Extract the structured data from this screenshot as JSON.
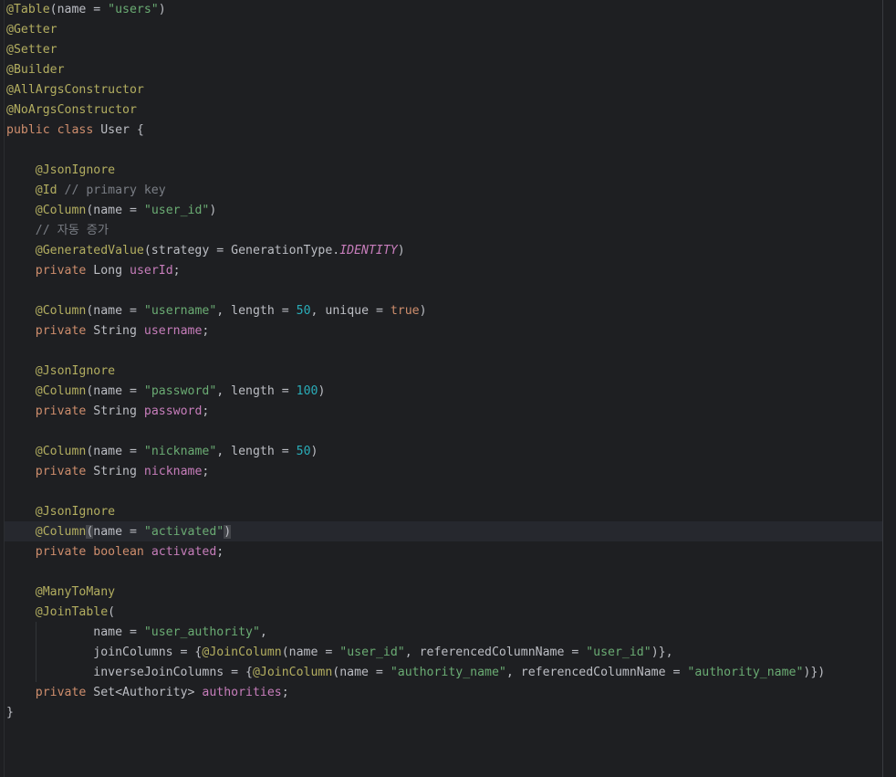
{
  "lines": [
    {
      "indent": 0,
      "tokens": [
        {
          "t": "@Table",
          "c": "ann"
        },
        {
          "t": "(name = ",
          "c": "plain"
        },
        {
          "t": "\"users\"",
          "c": "str"
        },
        {
          "t": ")",
          "c": "plain"
        }
      ]
    },
    {
      "indent": 0,
      "tokens": [
        {
          "t": "@Getter",
          "c": "ann"
        }
      ]
    },
    {
      "indent": 0,
      "tokens": [
        {
          "t": "@Setter",
          "c": "ann"
        }
      ]
    },
    {
      "indent": 0,
      "tokens": [
        {
          "t": "@Builder",
          "c": "ann"
        }
      ]
    },
    {
      "indent": 0,
      "tokens": [
        {
          "t": "@AllArgsConstructor",
          "c": "ann"
        }
      ]
    },
    {
      "indent": 0,
      "tokens": [
        {
          "t": "@NoArgsConstructor",
          "c": "ann"
        }
      ]
    },
    {
      "indent": 0,
      "tokens": [
        {
          "t": "public ",
          "c": "kw"
        },
        {
          "t": "class ",
          "c": "kw"
        },
        {
          "t": "User {",
          "c": "plain"
        }
      ]
    },
    {
      "indent": 0,
      "tokens": []
    },
    {
      "indent": 1,
      "tokens": [
        {
          "t": "@JsonIgnore",
          "c": "ann"
        }
      ]
    },
    {
      "indent": 1,
      "tokens": [
        {
          "t": "@Id",
          "c": "ann"
        },
        {
          "t": " // primary key",
          "c": "cmt"
        }
      ]
    },
    {
      "indent": 1,
      "tokens": [
        {
          "t": "@Column",
          "c": "ann"
        },
        {
          "t": "(name = ",
          "c": "plain"
        },
        {
          "t": "\"user_id\"",
          "c": "str"
        },
        {
          "t": ")",
          "c": "plain"
        }
      ]
    },
    {
      "indent": 1,
      "tokens": [
        {
          "t": "// 자동 증가",
          "c": "cmt"
        }
      ]
    },
    {
      "indent": 1,
      "tokens": [
        {
          "t": "@GeneratedValue",
          "c": "ann"
        },
        {
          "t": "(strategy = GenerationType.",
          "c": "plain"
        },
        {
          "t": "IDENTITY",
          "c": "static"
        },
        {
          "t": ")",
          "c": "plain"
        }
      ]
    },
    {
      "indent": 1,
      "tokens": [
        {
          "t": "private ",
          "c": "kw"
        },
        {
          "t": "Long ",
          "c": "plain"
        },
        {
          "t": "userId",
          "c": "field"
        },
        {
          "t": ";",
          "c": "plain"
        }
      ]
    },
    {
      "indent": 0,
      "tokens": []
    },
    {
      "indent": 1,
      "tokens": [
        {
          "t": "@Column",
          "c": "ann"
        },
        {
          "t": "(name = ",
          "c": "plain"
        },
        {
          "t": "\"username\"",
          "c": "str"
        },
        {
          "t": ", length = ",
          "c": "plain"
        },
        {
          "t": "50",
          "c": "num"
        },
        {
          "t": ", unique = ",
          "c": "plain"
        },
        {
          "t": "true",
          "c": "kw"
        },
        {
          "t": ")",
          "c": "plain"
        }
      ]
    },
    {
      "indent": 1,
      "tokens": [
        {
          "t": "private ",
          "c": "kw"
        },
        {
          "t": "String ",
          "c": "plain"
        },
        {
          "t": "username",
          "c": "field"
        },
        {
          "t": ";",
          "c": "plain"
        }
      ]
    },
    {
      "indent": 0,
      "tokens": []
    },
    {
      "indent": 1,
      "tokens": [
        {
          "t": "@JsonIgnore",
          "c": "ann"
        }
      ]
    },
    {
      "indent": 1,
      "tokens": [
        {
          "t": "@Column",
          "c": "ann"
        },
        {
          "t": "(name = ",
          "c": "plain"
        },
        {
          "t": "\"password\"",
          "c": "str"
        },
        {
          "t": ", length = ",
          "c": "plain"
        },
        {
          "t": "100",
          "c": "num"
        },
        {
          "t": ")",
          "c": "plain"
        }
      ]
    },
    {
      "indent": 1,
      "tokens": [
        {
          "t": "private ",
          "c": "kw"
        },
        {
          "t": "String ",
          "c": "plain"
        },
        {
          "t": "password",
          "c": "field"
        },
        {
          "t": ";",
          "c": "plain"
        }
      ]
    },
    {
      "indent": 0,
      "tokens": []
    },
    {
      "indent": 1,
      "tokens": [
        {
          "t": "@Column",
          "c": "ann"
        },
        {
          "t": "(name = ",
          "c": "plain"
        },
        {
          "t": "\"nickname\"",
          "c": "str"
        },
        {
          "t": ", length = ",
          "c": "plain"
        },
        {
          "t": "50",
          "c": "num"
        },
        {
          "t": ")",
          "c": "plain"
        }
      ]
    },
    {
      "indent": 1,
      "tokens": [
        {
          "t": "private ",
          "c": "kw"
        },
        {
          "t": "String ",
          "c": "plain"
        },
        {
          "t": "nickname",
          "c": "field"
        },
        {
          "t": ";",
          "c": "plain"
        }
      ]
    },
    {
      "indent": 0,
      "tokens": []
    },
    {
      "indent": 1,
      "tokens": [
        {
          "t": "@JsonIgnore",
          "c": "ann"
        }
      ]
    },
    {
      "indent": 1,
      "tokens": [
        {
          "t": "@Column",
          "c": "ann"
        },
        {
          "t": "(",
          "c": "plain brace-hl"
        },
        {
          "t": "name = ",
          "c": "plain"
        },
        {
          "t": "\"activated\"",
          "c": "str"
        },
        {
          "t": ")",
          "c": "plain brace-hl"
        }
      ]
    },
    {
      "indent": 1,
      "tokens": [
        {
          "t": "private ",
          "c": "kw"
        },
        {
          "t": "boolean ",
          "c": "kw"
        },
        {
          "t": "activated",
          "c": "field"
        },
        {
          "t": ";",
          "c": "plain"
        }
      ]
    },
    {
      "indent": 0,
      "tokens": []
    },
    {
      "indent": 1,
      "tokens": [
        {
          "t": "@ManyToMany",
          "c": "ann"
        }
      ]
    },
    {
      "indent": 1,
      "tokens": [
        {
          "t": "@JoinTable",
          "c": "ann"
        },
        {
          "t": "(",
          "c": "plain"
        }
      ]
    },
    {
      "indent": 3,
      "tokens": [
        {
          "t": "name = ",
          "c": "plain"
        },
        {
          "t": "\"user_authority\"",
          "c": "str"
        },
        {
          "t": ",",
          "c": "plain"
        }
      ]
    },
    {
      "indent": 3,
      "tokens": [
        {
          "t": "joinColumns = {",
          "c": "plain"
        },
        {
          "t": "@JoinColumn",
          "c": "ann"
        },
        {
          "t": "(name = ",
          "c": "plain"
        },
        {
          "t": "\"user_id\"",
          "c": "str"
        },
        {
          "t": ", referencedColumnName = ",
          "c": "plain"
        },
        {
          "t": "\"user_id\"",
          "c": "str"
        },
        {
          "t": ")},",
          "c": "plain"
        }
      ]
    },
    {
      "indent": 3,
      "tokens": [
        {
          "t": "inverseJoinColumns = {",
          "c": "plain"
        },
        {
          "t": "@JoinColumn",
          "c": "ann"
        },
        {
          "t": "(name = ",
          "c": "plain"
        },
        {
          "t": "\"authority_name\"",
          "c": "str"
        },
        {
          "t": ", referencedColumnName = ",
          "c": "plain"
        },
        {
          "t": "\"authority_name\"",
          "c": "str"
        },
        {
          "t": ")})",
          "c": "plain"
        }
      ]
    },
    {
      "indent": 1,
      "tokens": [
        {
          "t": "private ",
          "c": "kw"
        },
        {
          "t": "Set<Authority> ",
          "c": "plain"
        },
        {
          "t": "authorities",
          "c": "field"
        },
        {
          "t": ";",
          "c": "plain"
        }
      ]
    },
    {
      "indent": 0,
      "tokens": [
        {
          "t": "}",
          "c": "plain"
        }
      ]
    }
  ]
}
